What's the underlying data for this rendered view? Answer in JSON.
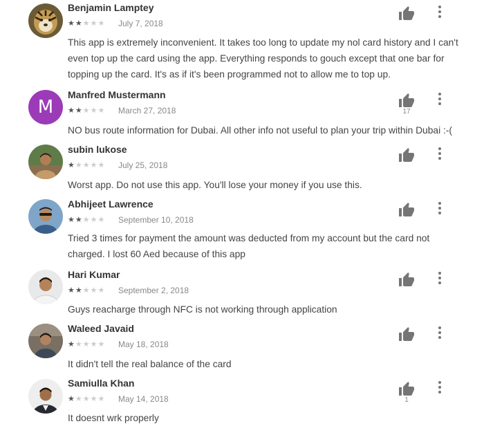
{
  "reviews": [
    {
      "author": "Benjamin Lamptey",
      "rating": 2,
      "date": "July 7, 2018",
      "text": "This app is extremely inconvenient. It takes too long to update my nol card history and I can't even top up the card using the app. Everything responds to gouch except that one bar for topping up the card. It's as if it's been programmed not to allow me to top up.",
      "helpful": "",
      "avatar": "photo-tiger"
    },
    {
      "author": "Manfred Mustermann",
      "rating": 2,
      "date": "March 27, 2018",
      "text": "NO bus route information for Dubai. All other info not useful to plan your trip within Dubai :-(",
      "helpful": "17",
      "avatar_letter": "M",
      "avatar_color": "#9c3bb8"
    },
    {
      "author": "subin lukose",
      "rating": 1,
      "date": "July 25, 2018",
      "text": "Worst app. Do not use this app. You'll lose your money if you use this.",
      "helpful": "",
      "avatar": "photo-person-outdoor"
    },
    {
      "author": "Abhijeet Lawrence",
      "rating": 2,
      "date": "September 10, 2018",
      "text": "Tried 3 times for payment the amount was deducted from my account but the card not charged. I lost 60 Aed because of this app",
      "helpful": "",
      "avatar": "photo-person-sunglasses"
    },
    {
      "author": "Hari Kumar",
      "rating": 2,
      "date": "September 2, 2018",
      "text": "Guys reacharge through NFC is not working through application",
      "helpful": "",
      "avatar": "photo-person-portrait"
    },
    {
      "author": "Waleed Javaid",
      "rating": 1,
      "date": "May 18, 2018",
      "text": "It didn't tell the real balance of the card",
      "helpful": "",
      "avatar": "photo-person-indoor"
    },
    {
      "author": "Samiulla Khan",
      "rating": 1,
      "date": "May 14, 2018",
      "text": "It doesnt wrk properly",
      "helpful": "1",
      "avatar": "photo-person-formal"
    }
  ],
  "colors": {
    "thumb_icon": "#757575",
    "more_icon": "#757575",
    "star_filled": "#555555",
    "star_empty": "#cccccc"
  }
}
